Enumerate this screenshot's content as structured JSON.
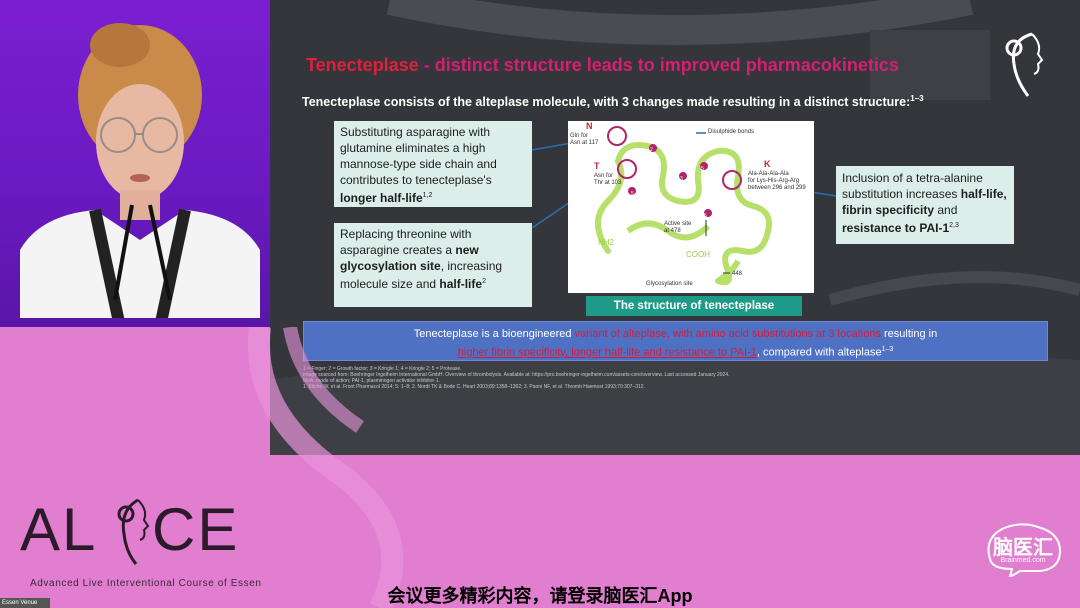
{
  "slide": {
    "title_part1": "Tenecteplase",
    "title_part2": " - distinct structure leads to improved pharmacokinetics",
    "subtitle": "Tenecteplase consists of the alteplase molecule, with 3 changes made resulting in a distinct structure:",
    "subtitle_sup": "1–3",
    "callout1": {
      "text": "Substituting asparagine with glutamine eliminates a high mannose-type side chain and contributes to tenecteplase's ",
      "bold": "longer half-life",
      "sup": "1,2"
    },
    "callout2": {
      "text": "Replacing threonine with asparagine creates a ",
      "bold1": "new glycosylation site",
      "text2": ", increasing molecule size and ",
      "bold2": "half-life",
      "sup": "2"
    },
    "callout3": {
      "text": "Inclusion of a tetra-alanine substitution increases ",
      "bold": "half-life, fibrin specificity",
      "text2": " and ",
      "bold2": "resistance to PAI-1",
      "sup": "2,3"
    },
    "diagram": {
      "label_n": "N",
      "label_n_sub": "Gln for\nAsn at 117",
      "label_t": "T",
      "label_t_sub": "Asn for\nThr at 103",
      "label_k": "K",
      "label_k_sub": "Ala-Ala-Ala-Ala\nfor Lys-His-Arg-Arg\nbetween 296 and 299",
      "disulphide": "Disulphide bonds",
      "active_site": "Active site\nat 478",
      "nh2": "NH2",
      "cooh": "COOH",
      "glyco": "Glycosylation site",
      "n448": "448",
      "circle_numbers": [
        "1",
        "2",
        "3",
        "4",
        "5",
        "5",
        "5"
      ]
    },
    "caption": "The structure of tenecteplase",
    "bluebar": {
      "p1": "Tenecteplase is a bioengineered ",
      "p2": "variant of alteplase, with amino acid substitutions at 3 locations",
      "p3": " resulting in",
      "p4": "higher fibrin specificity, longer half-life and resistance to PAI-1",
      "p5": ", compared with alteplase",
      "sup": "1–3"
    },
    "refs": [
      "1 = Finger; 2 = Growth factor; 3 = Kringle 1; 4 = Kringle 2; 5 = Protease.",
      "Image sourced from: Boehringer Ingelheim International GmbH. Overview of thrombolysis. Available at: https://pro.boehringer-ingelheim.com/assets-core/overview. Last accessed January 2024.",
      "MoA, mode of action; PAI-1, plasminogen activator inhibitor-1.",
      "1. Kliche W, et al. Front Pharmacol 2014; 5: 1–8; 2. Nordt TK & Bode C. Heart 2003;89:1358–1362; 3. Paoni NF, et al. Thromb Haemost 1993;70:307–312."
    ]
  },
  "branding": {
    "alice_logo": "AL CE",
    "alice_tagline": "Advanced Live Interventional Course of Essen",
    "venue_label": "Essen Venue",
    "platform_name": "脑医汇",
    "platform_sub": "Brainmed.com"
  },
  "subtitle_caption": "会议更多精彩内容，请登录脑医汇App",
  "colors": {
    "background": "#e27ecf",
    "speaker_bg": "#7a1fd0",
    "slide_title": "#d61f6e",
    "accent_red": "#e0203a",
    "callout_bg": "#dceee9",
    "teal": "#1e9b88",
    "blue_bar": "#4f71c3"
  }
}
